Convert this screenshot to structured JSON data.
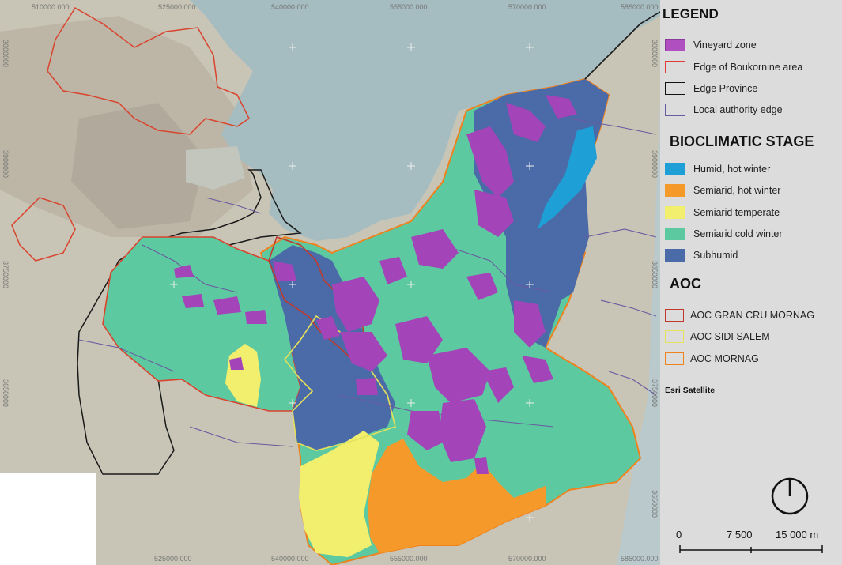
{
  "legend": {
    "title": "LEGEND",
    "items": [
      {
        "label": "Vineyard zone",
        "fill": "#b04fc0",
        "stroke": "#8a3c99"
      },
      {
        "label": "Edge of Boukornine area",
        "fill": "none",
        "stroke": "#e03a3a"
      },
      {
        "label": "Edge Province",
        "fill": "none",
        "stroke": "#111111"
      },
      {
        "label": "Local authority edge",
        "fill": "none",
        "stroke": "#6a5aa0"
      }
    ]
  },
  "bioclimatic": {
    "title": "BIOCLIMATIC STAGE",
    "items": [
      {
        "label": "Humid, hot winter",
        "fill": "#1e9fd6"
      },
      {
        "label": "Semiarid, hot winter",
        "fill": "#f59a2a"
      },
      {
        "label": "Semiarid temperate",
        "fill": "#f2ef6e"
      },
      {
        "label": "Semiarid cold winter",
        "fill": "#5cc9a0"
      },
      {
        "label": "Subhumid",
        "fill": "#4b6aa8"
      }
    ]
  },
  "aoc": {
    "title": "AOC",
    "items": [
      {
        "label": "AOC GRAN CRU MORNAG",
        "stroke": "#c0392b"
      },
      {
        "label": "AOC SIDI SALEM",
        "stroke": "#e6e05a"
      },
      {
        "label": "AOC MORNAG",
        "stroke": "#f0821e"
      }
    ]
  },
  "basemap_label": "Esri Satellite",
  "scale_bar": {
    "labels": [
      "0",
      "7 500",
      "15 000 m"
    ]
  },
  "top_coords": [
    "510000.000",
    "525000.000",
    "540000.000",
    "555000.000",
    "570000.000",
    "585000.000"
  ],
  "bottom_coords": [
    "525000.000",
    "540000.000",
    "555000.000",
    "570000.000",
    "585000.000"
  ],
  "left_coords": [
    "3000000",
    "3900000",
    "3750000",
    "3650000"
  ],
  "right_coords": [
    "3000000",
    "3900000",
    "3850000",
    "3750000",
    "3650000"
  ],
  "colors": {
    "sea": "#a8bfc4",
    "land": "#c9c6b8",
    "urban": "#b9b3a6",
    "subhumid": "#4b6aa8",
    "cold_winter": "#5cc9a0",
    "temperate": "#f2ef6e",
    "hot_winter": "#f59a2a",
    "humid": "#1e9fd6",
    "vineyard": "#a344b8"
  }
}
